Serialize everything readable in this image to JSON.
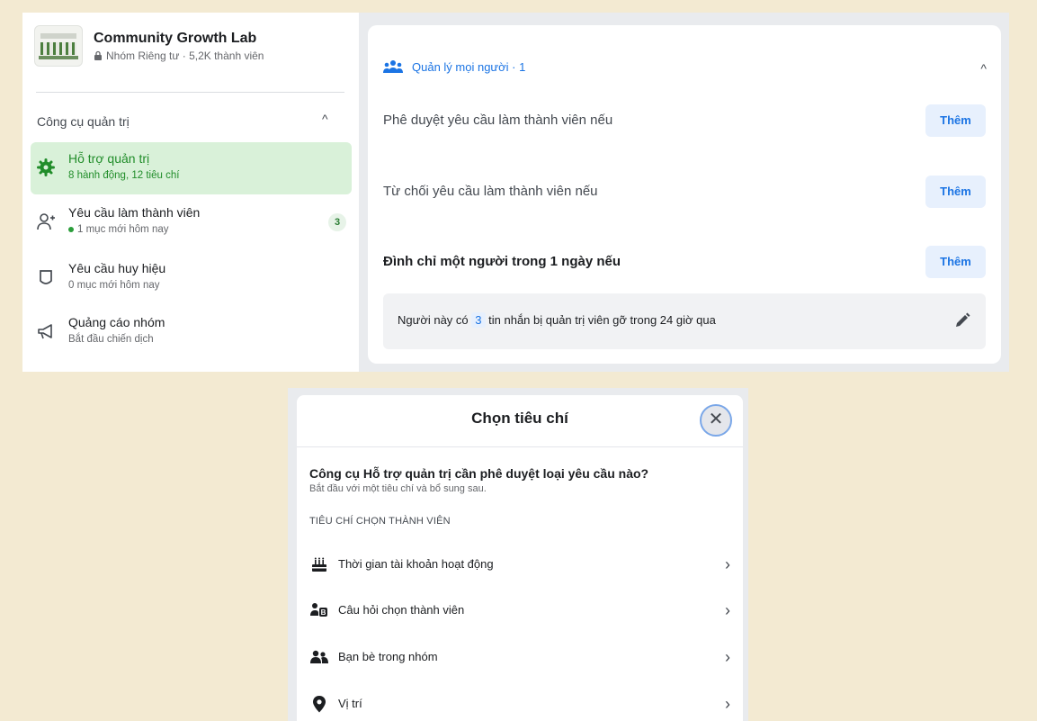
{
  "group": {
    "name": "Community Growth Lab",
    "privacy": "Nhóm Riêng tư · 5,2K thành viên"
  },
  "sidebar": {
    "section_title": "Công cụ quản trị",
    "items": [
      {
        "label": "Hỗ trợ quản trị",
        "sub": "8 hành động, 12 tiêu chí",
        "icon": "gear-icon"
      },
      {
        "label": "Yêu cầu làm thành viên",
        "sub": "1 mục mới hôm nay",
        "badge": "3",
        "icon": "add-person-icon"
      },
      {
        "label": "Yêu cầu huy hiệu",
        "sub": "0 mục mới hôm nay",
        "icon": "shield-icon"
      },
      {
        "label": "Quảng cáo nhóm",
        "sub": "Bắt đầu chiến dịch",
        "icon": "megaphone-icon"
      }
    ]
  },
  "card": {
    "header": "Quản lý mọi người · 1",
    "rows": [
      {
        "label": "Phê duyệt yêu cầu làm thành viên nếu",
        "button": "Thêm"
      },
      {
        "label": "Từ chối yêu cầu làm thành viên nếu",
        "button": "Thêm"
      },
      {
        "label": "Đình chỉ một người trong 1 ngày nếu",
        "button": "Thêm"
      }
    ],
    "condition": {
      "prefix": "Người này có",
      "count": "3",
      "suffix": "tin nhắn bị quản trị viên gỡ trong 24 giờ qua"
    }
  },
  "dialog": {
    "title": "Chọn tiêu chí",
    "question": "Công cụ Hỗ trợ quản trị cần phê duyệt loại yêu cầu nào?",
    "hint": "Bắt đầu với một tiêu chí và bổ sung sau.",
    "section": "TIÊU CHÍ CHỌN THÀNH VIÊN",
    "criteria": [
      {
        "label": "Thời gian tài khoản hoạt động",
        "icon": "cake-icon"
      },
      {
        "label": "Câu hỏi chọn thành viên",
        "icon": "question-person-icon"
      },
      {
        "label": "Bạn bè trong nhóm",
        "icon": "friends-icon"
      },
      {
        "label": "Vị trí",
        "icon": "location-pin-icon"
      }
    ]
  },
  "colors": {
    "accent": "#1b74e4",
    "active_green": "#218d2a",
    "background": "#f3ead2"
  }
}
